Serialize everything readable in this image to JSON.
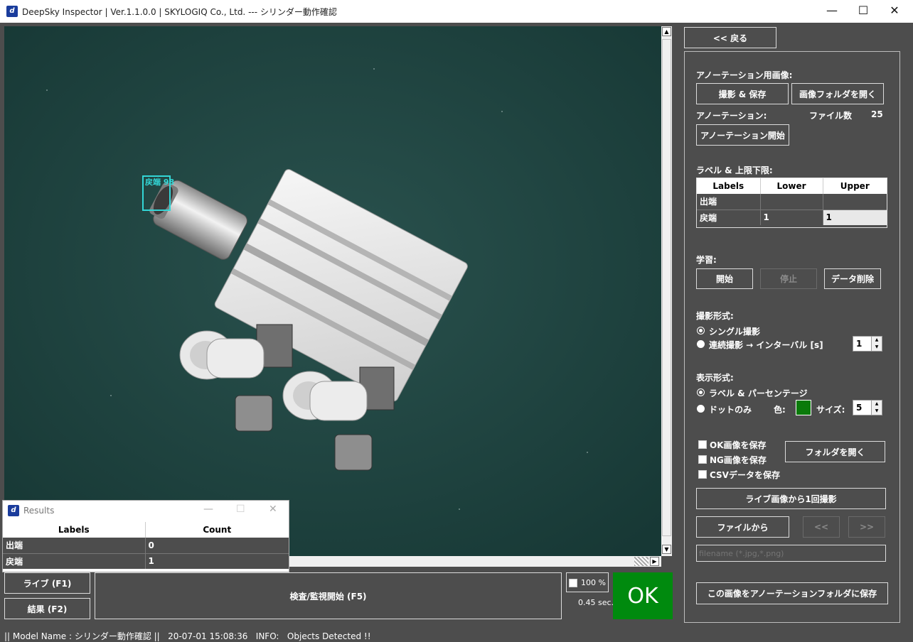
{
  "window": {
    "title": "DeepSky Inspector | Ver.1.1.0.0 | SKYLOGIQ Co., Ltd. --- シリンダー動作確認",
    "minimize": "—",
    "maximize": "☐",
    "close": "✕"
  },
  "viewer": {
    "detection_label": "戻端  98",
    "detection_color": "#33d6d6"
  },
  "controls": {
    "live_button": "ライブ (F1)",
    "results_button": "結果 (F2)",
    "start_button": "検査/監視開始 (F5)",
    "zoom_label": "100 %",
    "time_label": "0.45 sec.",
    "judge": "OK",
    "judge_color": "#008a0e"
  },
  "right_panel": {
    "back_button": "<< 戻る",
    "annot_image_label": "アノーテーション用画像:",
    "capture_save_button": "撮影 & 保存",
    "open_image_folder_button": "画像フォルダを開く",
    "annotation_label": "アノーテーション:",
    "file_count_label": "ファイル数",
    "file_count": "25",
    "annotation_start_button": "アノーテーション開始",
    "label_limits_label": "ラベル & 上限下限:",
    "table": {
      "headers": [
        "Labels",
        "Lower",
        "Upper"
      ],
      "rows": [
        {
          "label": "出端",
          "lower": "",
          "upper": ""
        },
        {
          "label": "戻端",
          "lower": "1",
          "upper": "1"
        }
      ]
    },
    "learning_label": "学習:",
    "learn_start_button": "開始",
    "learn_stop_button": "停止",
    "delete_data_button": "データ削除",
    "capture_mode_label": "撮影形式:",
    "single_capture": "シングル撮影",
    "continuous_capture": "連続撮影 → インターバル [s]",
    "interval_value": "1",
    "display_mode_label": "表示形式:",
    "label_percentage": "ラベル & パーセンテージ",
    "dot_only": "ドットのみ",
    "color_label": "色:",
    "dot_color": "#0a7a0a",
    "size_label": "サイズ:",
    "size_value": "5",
    "save_ok": "OK画像を保存",
    "save_ng": "NG画像を保存",
    "save_csv": "CSVデータを保存",
    "open_folder_button": "フォルダを開く",
    "capture_once_button": "ライブ画像から1回撮影",
    "from_file_button": "ファイルから",
    "prev_button": "<<",
    "next_button": ">>",
    "filename_placeholder": "filename (*.jpg,*.png)",
    "save_to_annot_button": "この画像をアノーテーションフォルダに保存"
  },
  "results_window": {
    "title": "Results",
    "headers": [
      "Labels",
      "Count"
    ],
    "rows": [
      {
        "label": "出端",
        "count": "0"
      },
      {
        "label": "戻端",
        "count": "1"
      }
    ]
  },
  "status": {
    "text": "|| Model Name : シリンダー動作確認 ||   20-07-01 15:08:36   INFO:   Objects Detected !!"
  }
}
